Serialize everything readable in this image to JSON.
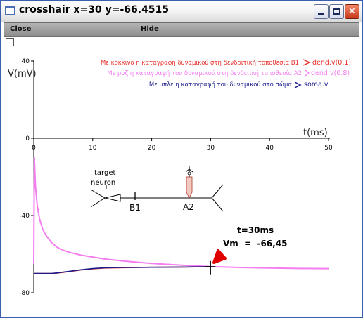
{
  "window": {
    "title": "crosshair x=30 y=-66.4515",
    "icon": "window-icon",
    "controls": [
      "minimize-icon",
      "maximize-icon",
      "close-icon"
    ]
  },
  "menu": {
    "close_label": "Close",
    "hide_label": "Hide"
  },
  "plot": {
    "ylabel": "V(mV)",
    "xlabel": "t(ms)",
    "y_ticks": [
      "40",
      "0",
      "-40",
      "-80"
    ],
    "x_ticks": [
      "0",
      "10",
      "20",
      "30",
      "40",
      "50"
    ],
    "legend": [
      {
        "text": "Με κόκκινο η καταγραφή δυναμικού στη δενδριτική τοποθεσία B1",
        "name": "dend.v(0.1)",
        "color": "#e8302a"
      },
      {
        "text": "Με ροζ η καταγραφή του δυναμικού στη δενδιτική τοποθεσία A2",
        "name": "dend.v(0.8)",
        "color": "#f47ef0"
      },
      {
        "text": "Με μπλε η καταγραφή του δυναμικού στο σώμα",
        "name": "soma.v",
        "color": "#1a1a8c"
      }
    ],
    "annotation": {
      "time": "t=30ms",
      "vm": "Vm  =  -66,45"
    },
    "neuron": {
      "label_line1": "target",
      "label_line2": "neuron",
      "site_b1": "B1",
      "site_a2": "A2"
    }
  },
  "chart_data": {
    "type": "line",
    "xlim": [
      0,
      50
    ],
    "ylim": [
      -80,
      40
    ],
    "xlabel": "t(ms)",
    "ylabel": "V(mV)",
    "series": [
      {
        "name": "dend.v(0.8)",
        "color": "#f47ef0",
        "x": [
          0,
          0.1,
          0.3,
          0.6,
          1,
          1.5,
          2,
          3,
          4,
          5,
          6,
          8,
          10,
          12,
          15,
          20,
          25,
          30,
          35,
          40,
          45,
          50
        ],
        "y": [
          -65,
          -10,
          -25,
          -35,
          -42,
          -47,
          -50,
          -54,
          -56.5,
          -58,
          -59,
          -60.5,
          -61.5,
          -62.5,
          -63.5,
          -64.8,
          -65.7,
          -66.45,
          -66.9,
          -67.2,
          -67.4,
          -67.5
        ]
      },
      {
        "name": "dend.v(0.1)",
        "color": "#e8302a",
        "x": [
          0,
          0.5,
          1,
          1.5,
          2,
          3,
          4,
          5,
          6,
          8,
          10,
          12,
          15,
          20,
          25,
          30
        ],
        "y": [
          -70,
          -70,
          -70,
          -70,
          -70,
          -70,
          -69.8,
          -69.4,
          -69,
          -68.2,
          -67.6,
          -67.2,
          -67,
          -66.8,
          -66.7,
          -66.5
        ]
      },
      {
        "name": "soma.v",
        "color": "#1a1a8c",
        "x": [
          0,
          0.5,
          1,
          1.5,
          2,
          3,
          4,
          5,
          6,
          8,
          10,
          12,
          15,
          20,
          25,
          30
        ],
        "y": [
          -70,
          -70,
          -70,
          -70,
          -70,
          -70,
          -69.7,
          -69.3,
          -68.9,
          -68.1,
          -67.5,
          -67.1,
          -66.9,
          -66.8,
          -66.7,
          -66.5
        ]
      }
    ],
    "crosshair": {
      "x": 30,
      "y": -66.45
    },
    "legend_position": "top-right",
    "grid": false
  }
}
